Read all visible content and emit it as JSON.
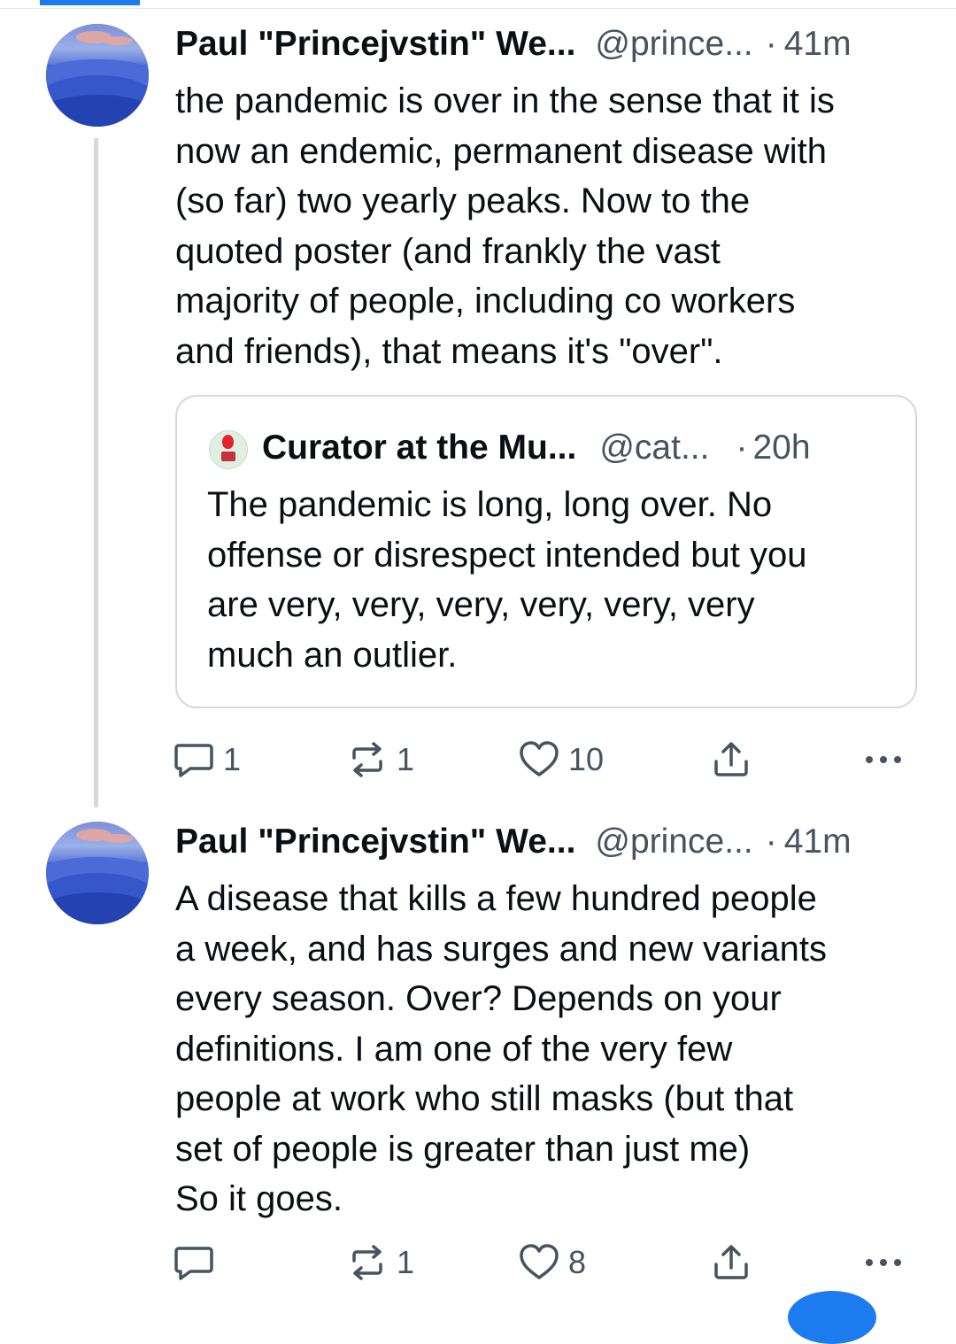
{
  "posts": [
    {
      "author_name": "Paul \"Princejvstin\" We...",
      "handle": "@prince...",
      "separator": "·",
      "time": "41m",
      "text": "the pandemic is over in the sense that it is\nnow an endemic, permanent disease with\n(so far) two yearly peaks. Now to the\nquoted poster (and frankly the vast\nmajority of people, including co workers\nand friends), that means it's \"over\".",
      "quote": {
        "author_name": "Curator at the Mu...",
        "handle": "@cat...",
        "separator": "·",
        "time": "20h",
        "text": "The pandemic is long, long over. No\noffense or disrespect intended but you\nare very, very, very, very, very, very\nmuch an outlier."
      },
      "actions": {
        "reply_count": "1",
        "repost_count": "1",
        "like_count": "10"
      }
    },
    {
      "author_name": "Paul \"Princejvstin\" We...",
      "handle": "@prince...",
      "separator": "·",
      "time": "41m",
      "text": "A disease that kills a few hundred people\na week, and has surges and new variants\nevery season. Over? Depends on  your\ndefinitions. I am one of the very few\npeople at work who still masks (but that\nset of people is greater than just me)\nSo it goes.",
      "actions": {
        "reply_count": "",
        "repost_count": "1",
        "like_count": "8"
      }
    }
  ],
  "icons": {
    "reply": "speech-bubble-icon",
    "repost": "repost-arrows-icon",
    "like": "heart-icon",
    "share": "share-upload-icon",
    "more": "ellipsis-icon"
  },
  "colors": {
    "accent": "#1d7bf0",
    "text": "#0b0f14",
    "muted": "#47535e",
    "border": "#d4d9de"
  }
}
